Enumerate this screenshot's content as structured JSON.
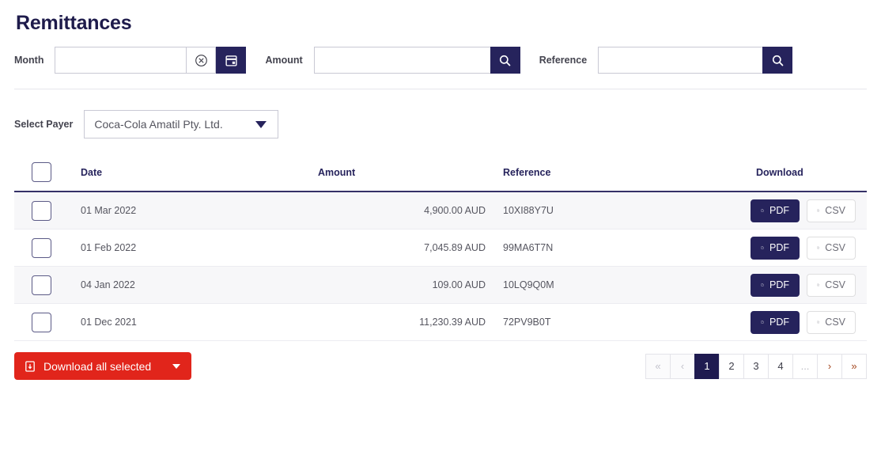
{
  "page_title": "Remittances",
  "filters": {
    "month": {
      "label": "Month",
      "value": "",
      "placeholder": "",
      "clear_icon": "circle-x-icon",
      "calendar_icon": "calendar-icon"
    },
    "amount": {
      "label": "Amount",
      "value": "",
      "placeholder": "",
      "search_icon": "search-icon"
    },
    "reference": {
      "label": "Reference",
      "value": "",
      "placeholder": "",
      "search_icon": "search-icon"
    }
  },
  "payer": {
    "label": "Select Payer",
    "selected": "Coca-Cola Amatil Pty. Ltd.",
    "caret_icon": "chevron-down-icon"
  },
  "table": {
    "columns": [
      "",
      "Date",
      "Amount",
      "Reference",
      "Download"
    ],
    "rows": [
      {
        "date": "01 Mar 2022",
        "amount": "4,900.00 AUD",
        "reference": "10XI88Y7U",
        "pdf": "PDF",
        "csv": "CSV"
      },
      {
        "date": "01 Feb 2022",
        "amount": "7,045.89 AUD",
        "reference": "99MA6T7N",
        "pdf": "PDF",
        "csv": "CSV"
      },
      {
        "date": "04 Jan 2022",
        "amount": "109.00 AUD",
        "reference": "10LQ9Q0M",
        "pdf": "PDF",
        "csv": "CSV"
      },
      {
        "date": "01 Dec 2021",
        "amount": "11,230.39 AUD",
        "reference": "72PV9B0T",
        "pdf": "PDF",
        "csv": "CSV"
      }
    ]
  },
  "footer": {
    "download_all_label": "Download all selected",
    "download_all_icon": "file-download-icon",
    "pagination": {
      "first": "«",
      "prev": "‹",
      "pages": [
        "1",
        "2",
        "3",
        "4"
      ],
      "ellipsis": "...",
      "next": "›",
      "last": "»",
      "active": "1"
    }
  },
  "colors": {
    "navy": "#26235c",
    "red": "#e1251b",
    "stripe": "#f7f7f9",
    "border": "#c9c9d4"
  }
}
